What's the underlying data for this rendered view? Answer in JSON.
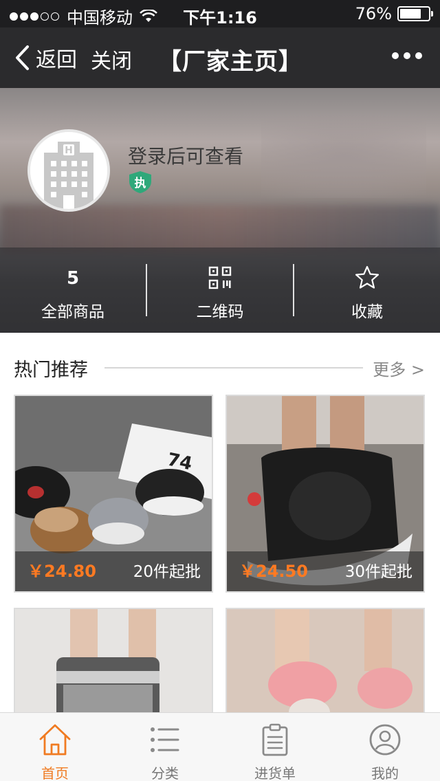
{
  "status_bar": {
    "carrier": "中国移动",
    "time": "下午1:16",
    "battery": "76%",
    "battery_level": 0.76,
    "signal_bars": 3
  },
  "nav": {
    "back_label": "返回",
    "close_label": "关闭",
    "title": "【厂家主页】"
  },
  "profile": {
    "name_placeholder": "登录后可查看",
    "badge_text": "执",
    "badge_color": "#2fa87a"
  },
  "stats": {
    "products_count": "5",
    "products_label": "全部商品",
    "qrcode_label": "二维码",
    "favorite_label": "收藏"
  },
  "section": {
    "title": "热门推荐",
    "more": "更多 >"
  },
  "products": [
    {
      "price": "￥24.80",
      "moq": "20件起批"
    },
    {
      "price": "￥24.50",
      "moq": "30件起批"
    },
    {
      "price": "",
      "moq": ""
    },
    {
      "price": "",
      "moq": ""
    }
  ],
  "tabbar": {
    "accent": "#f07b22",
    "items": [
      {
        "label": "首页",
        "icon": "home-icon",
        "active": true
      },
      {
        "label": "分类",
        "icon": "list-icon",
        "active": false
      },
      {
        "label": "进货单",
        "icon": "clipboard-icon",
        "active": false
      },
      {
        "label": "我的",
        "icon": "user-icon",
        "active": false
      }
    ]
  }
}
